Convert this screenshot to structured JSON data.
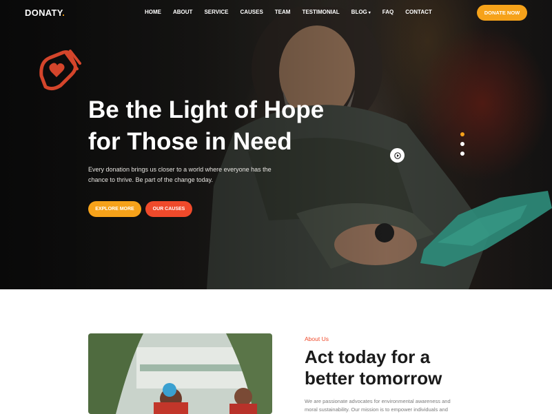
{
  "brand": {
    "name": "DONATY",
    "dot": ".",
    "accent": "#f6a21a",
    "accent2": "#ef4a2b"
  },
  "nav": {
    "items": [
      {
        "label": "HOME"
      },
      {
        "label": "ABOUT"
      },
      {
        "label": "SERVICE"
      },
      {
        "label": "CAUSES"
      },
      {
        "label": "TEAM"
      },
      {
        "label": "TESTIMONIAL"
      },
      {
        "label": "BLOG",
        "has_dropdown": true
      },
      {
        "label": "FAQ"
      },
      {
        "label": "CONTACT"
      }
    ],
    "cta": "DONATE NOW"
  },
  "hero": {
    "title_line1": "Be the Light of Hope",
    "title_line2": "for Those in Need",
    "text": "Every donation brings us closer to a world where everyone has the chance to thrive. Be part of the change today.",
    "primary_button": "EXPLORE MORE",
    "secondary_button": "OUR CAUSES",
    "slider": {
      "count": 3,
      "active": 0
    },
    "icons": {
      "play": "play-icon",
      "hand": "hand-heart-icon"
    }
  },
  "about": {
    "label": "About Us",
    "title_line1": "Act today for a",
    "title_line2": "better tomorrow",
    "text": "We are passionate advocates for environmental awareness and moral sustainability. Our mission is to empower individuals and"
  }
}
